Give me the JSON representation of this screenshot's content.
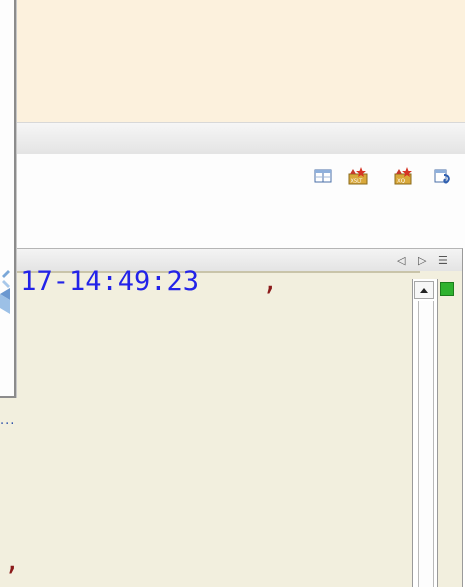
{
  "toolbar": {
    "buttons": [
      {
        "icon": "grid-view-icon"
      },
      {
        "icon": "xslt-transform-icon",
        "label": "XSLT"
      },
      {
        "icon": "xquery-transform-icon",
        "label": "XQ"
      },
      {
        "icon": "attached-schema-icon"
      }
    ]
  },
  "editor": {
    "tab_controls": {
      "previous": "◁",
      "next": "▷",
      "list": "☰"
    },
    "lines": {
      "line1_text": "-17-14:49:23 ",
      "line1_comma": ",",
      "line_last_comma": ","
    },
    "status_color": "#2fb22f"
  },
  "left_pane": {
    "more_link": "..."
  },
  "colors": {
    "top_panel": "#fcf1dd",
    "editor_background": "#f2efde",
    "code_blue": "#2323e8",
    "code_red": "#8b1a1a"
  }
}
